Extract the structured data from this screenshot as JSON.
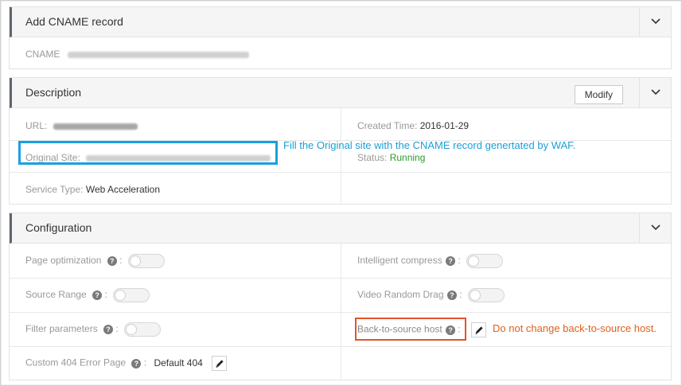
{
  "cname_panel": {
    "title": "Add CNAME record",
    "cname_label": "CNAME"
  },
  "description_panel": {
    "title": "Description",
    "modify_label": "Modify",
    "url_label": "URL:",
    "original_site_label": "Original Site:",
    "service_type_label": "Service Type:",
    "service_type_value": "Web Acceleration",
    "created_time_label": "Created Time:",
    "created_time_value": "2016-01-29",
    "status_label": "Status:",
    "status_value": "Running",
    "status_color": "#2c9a2c"
  },
  "configuration_panel": {
    "title": "Configuration",
    "page_optimization_label": "Page optimization",
    "source_range_label": "Source Range",
    "filter_parameters_label": "Filter parameters",
    "custom_404_label": "Custom 404 Error Page",
    "custom_404_value": "Default 404",
    "intelligent_compress_label": "Intelligent compress",
    "video_random_drag_label": "Video Random Drag",
    "back_to_source_host_label": "Back-to-source host",
    "help_glyph": "?",
    "colon": ":",
    "help_icon": "question-circle-icon",
    "edit_icon": "pencil-icon"
  },
  "annotations": {
    "original_site_note": "Fill the Original site with the CNAME record genertated by WAF.",
    "original_site_color": "#1aa0e0",
    "back_to_source_note": "Do not change back-to-source host.",
    "back_to_source_color": "#e2532b"
  }
}
